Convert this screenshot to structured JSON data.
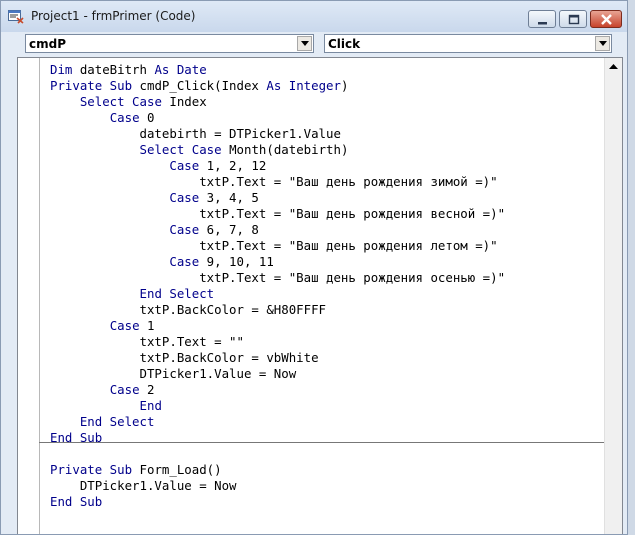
{
  "window": {
    "title": "Project1 - frmPrimer (Code)"
  },
  "combos": {
    "object": "cmdP",
    "procedure": "Click"
  },
  "code": {
    "block1": [
      [
        {
          "t": "Dim ",
          "k": 1
        },
        {
          "t": "dateBitrh "
        },
        {
          "t": "As ",
          "k": 1
        },
        {
          "t": "Date",
          "k": 1
        }
      ],
      [
        {
          "t": "Private Sub ",
          "k": 1
        },
        {
          "t": "cmdP_Click(Index "
        },
        {
          "t": "As Integer",
          "k": 1
        },
        {
          "t": ")"
        }
      ],
      [
        {
          "t": "    "
        },
        {
          "t": "Select Case ",
          "k": 1
        },
        {
          "t": "Index"
        }
      ],
      [
        {
          "t": "        "
        },
        {
          "t": "Case ",
          "k": 1
        },
        {
          "t": "0"
        }
      ],
      [
        {
          "t": "            datebirth = DTPicker1.Value"
        }
      ],
      [
        {
          "t": "            "
        },
        {
          "t": "Select Case ",
          "k": 1
        },
        {
          "t": "Month(datebirth)"
        }
      ],
      [
        {
          "t": "                "
        },
        {
          "t": "Case ",
          "k": 1
        },
        {
          "t": "1, 2, 12"
        }
      ],
      [
        {
          "t": "                    txtP.Text = \"Ваш день рождения зимой =)\""
        }
      ],
      [
        {
          "t": "                "
        },
        {
          "t": "Case ",
          "k": 1
        },
        {
          "t": "3, 4, 5"
        }
      ],
      [
        {
          "t": "                    txtP.Text = \"Ваш день рождения весной =)\""
        }
      ],
      [
        {
          "t": "                "
        },
        {
          "t": "Case ",
          "k": 1
        },
        {
          "t": "6, 7, 8"
        }
      ],
      [
        {
          "t": "                    txtP.Text = \"Ваш день рождения летом =)\""
        }
      ],
      [
        {
          "t": "                "
        },
        {
          "t": "Case ",
          "k": 1
        },
        {
          "t": "9, 10, 11"
        }
      ],
      [
        {
          "t": "                    txtP.Text = \"Ваш день рождения осенью =)\""
        }
      ],
      [
        {
          "t": "            "
        },
        {
          "t": "End Select",
          "k": 1
        }
      ],
      [
        {
          "t": "            txtP.BackColor = &H80FFFF"
        }
      ],
      [
        {
          "t": "        "
        },
        {
          "t": "Case ",
          "k": 1
        },
        {
          "t": "1"
        }
      ],
      [
        {
          "t": "            txtP.Text = \"\""
        }
      ],
      [
        {
          "t": "            txtP.BackColor = vbWhite"
        }
      ],
      [
        {
          "t": "            DTPicker1.Value = Now"
        }
      ],
      [
        {
          "t": "        "
        },
        {
          "t": "Case ",
          "k": 1
        },
        {
          "t": "2"
        }
      ],
      [
        {
          "t": "            "
        },
        {
          "t": "End",
          "k": 1
        }
      ],
      [
        {
          "t": "    "
        },
        {
          "t": "End Select",
          "k": 1
        }
      ],
      [
        {
          "t": "End Sub",
          "k": 1
        }
      ]
    ],
    "block2": [
      [
        {
          "t": "Private Sub ",
          "k": 1
        },
        {
          "t": "Form_Load()"
        }
      ],
      [
        {
          "t": "    DTPicker1.Value = Now"
        }
      ],
      [
        {
          "t": "End Sub",
          "k": 1
        }
      ]
    ]
  },
  "colors": {
    "keyword": "#00008b",
    "text": "#000000"
  }
}
